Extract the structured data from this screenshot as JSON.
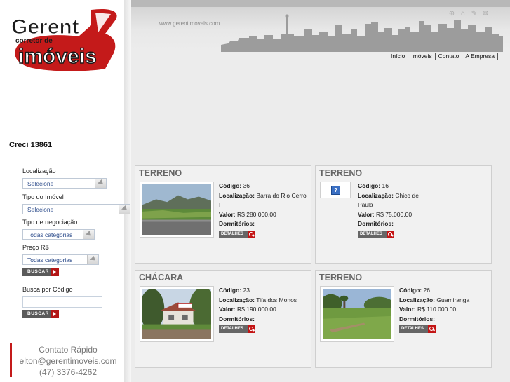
{
  "logo": {
    "line1": "Gerent",
    "line2": "corretor de",
    "line3": "imóveis"
  },
  "header": {
    "site_url": "www.gerentimoveis.com",
    "nav": [
      "Início",
      "Imóveis",
      "Contato",
      "A Empresa"
    ],
    "toolbar_icons": [
      "target-icon",
      "home-icon",
      "pencil-icon",
      "mail-icon"
    ]
  },
  "sidebar": {
    "creci": "Creci 13861",
    "localizacao_label": "Localização",
    "localizacao_value": "Selecione",
    "tipo_imovel_label": "Tipo do Imóvel",
    "tipo_imovel_value": "Selecione",
    "tipo_negociacao_label": "Tipo de negociação",
    "tipo_negociacao_value": "Todas categorias",
    "preco_label": "Preço R$",
    "preco_value": "Todas categorias",
    "buscar_label": "BUSCAR",
    "busca_codigo_label": "Busca por Código",
    "codigo_placeholder": "",
    "contact": {
      "title": "Contato Rápido",
      "email": "elton@gerentimoveis.com",
      "phone": "(47) 3376-4262"
    }
  },
  "labels": {
    "codigo": "Código:",
    "localizacao": "Localização:",
    "valor": "Valor:",
    "dormitorios": "Dormitórios:",
    "detalhes": "DETALHES"
  },
  "listings": [
    {
      "category": "TERRENO",
      "codigo": "36",
      "localizacao": "Barra do Rio Cerro I",
      "valor": "R$ 280.000.00",
      "dormitorios": "",
      "photo": "field"
    },
    {
      "category": "TERRENO",
      "codigo": "16",
      "localizacao": "Chico de Paula",
      "valor": "R$ 75.000.00",
      "dormitorios": "",
      "photo": "none"
    },
    {
      "category": "CHÁCARA",
      "codigo": "23",
      "localizacao": "Tifa dos Monos",
      "valor": "R$ 190.000.00",
      "dormitorios": "",
      "photo": "house"
    },
    {
      "category": "TERRENO",
      "codigo": "26",
      "localizacao": "Guamiranga",
      "valor": "R$ 110.000.00",
      "dormitorios": "",
      "photo": "grass"
    }
  ],
  "colors": {
    "accent_red": "#c41a1a",
    "select_text": "#2a4a8a"
  }
}
